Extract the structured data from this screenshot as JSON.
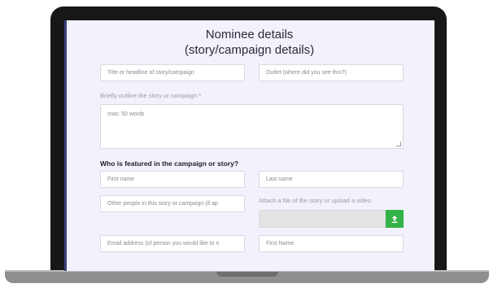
{
  "form": {
    "title_line1": "Nominee details",
    "title_line2": "(story/campaign details)",
    "headline_placeholder": "Title or headline of story/campaign",
    "outlet_placeholder": "Outlet (where did you see this?)",
    "outline_label": "Briefly outline the story or campaign *",
    "outline_placeholder": "max: 50 words",
    "featured_heading": "Who is featured in the campaign or story?",
    "first_name_placeholder": "First name",
    "last_name_placeholder": "Last name",
    "other_people_placeholder": "Other people in this story or campaign (if ap",
    "attach_label": "Attach a file of the story or upload a video",
    "email_placeholder": "Email address (of person you would like to n",
    "first_name2_placeholder": "First Name"
  },
  "icons": {
    "upload": "upload-icon"
  },
  "colors": {
    "screen_bg": "#f2f2fc",
    "upload_button": "#33b247",
    "bezel": "#171717"
  }
}
